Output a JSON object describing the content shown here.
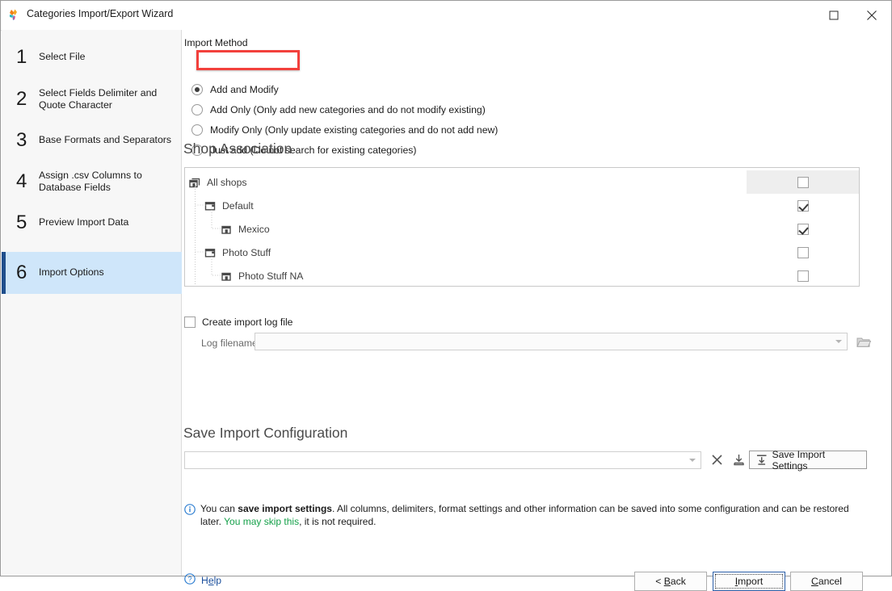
{
  "window": {
    "title": "Categories Import/Export Wizard",
    "icon": "app-logo-icon",
    "maximize_label": "Maximize",
    "close_label": "Close"
  },
  "sidebar": {
    "steps": [
      {
        "num": "1",
        "label": "Select File",
        "active": false
      },
      {
        "num": "2",
        "label": "Select Fields Delimiter and Quote Character",
        "active": false
      },
      {
        "num": "3",
        "label": "Base Formats and Separators",
        "active": false
      },
      {
        "num": "4",
        "label": "Assign .csv Columns to Database Fields",
        "active": false
      },
      {
        "num": "5",
        "label": "Preview Import Data",
        "active": false
      },
      {
        "num": "6",
        "label": "Import Options",
        "active": true
      }
    ]
  },
  "import_method": {
    "label": "Import Method",
    "selected": "Add and Modify",
    "highlight_color": "#f2403c",
    "options": [
      {
        "label": "Add and Modify",
        "checked": true
      },
      {
        "label": "Add Only (Only add new categories and do not modify existing)",
        "checked": false
      },
      {
        "label": "Modify Only (Only update existing categories and do not add new)",
        "checked": false
      },
      {
        "label": "Just add (Do not search for existing categories)",
        "checked": false
      }
    ]
  },
  "shop_association": {
    "heading": "Shop Association",
    "rows": [
      {
        "label": "All shops",
        "level": 0,
        "icon": "shop-icon",
        "checked": false,
        "header": true
      },
      {
        "label": "Default",
        "level": 1,
        "icon": "shop-group-icon",
        "checked": true,
        "header": false
      },
      {
        "label": "Mexico",
        "level": 2,
        "icon": "shop-icon",
        "checked": true,
        "header": false
      },
      {
        "label": "Photo Stuff",
        "level": 1,
        "icon": "shop-group-icon",
        "checked": false,
        "header": false
      },
      {
        "label": "Photo Stuff NA",
        "level": 2,
        "icon": "shop-icon",
        "checked": false,
        "header": false
      }
    ]
  },
  "log": {
    "create_log_label": "Create import log file",
    "create_log_checked": false,
    "filename_label": "Log filename",
    "filename_value": "",
    "filename_placeholder": "",
    "browse_icon": "folder-open-icon"
  },
  "save_config": {
    "heading": "Save Import Configuration",
    "config_value": "",
    "config_placeholder": "",
    "clear_icon": "close-x-icon",
    "load_icon": "download-icon",
    "save_button_label": "Save Import Settings",
    "save_button_icon": "save-down-icon"
  },
  "hint": {
    "icon": "info-icon",
    "text_1": "You can ",
    "text_bold": "save import settings",
    "text_2": ". All columns, delimiters, format settings and other information can be saved into some configuration and can be restored later. ",
    "text_green": "You may skip this",
    "text_3": ", it is not required."
  },
  "footer": {
    "help_icon": "help-circle-icon",
    "help_label": "Help",
    "back_label": "< Back",
    "back_mnemonic": "B",
    "import_label": "Import",
    "import_mnemonic": "I",
    "cancel_label": "Cancel",
    "cancel_mnemonic": "C"
  }
}
